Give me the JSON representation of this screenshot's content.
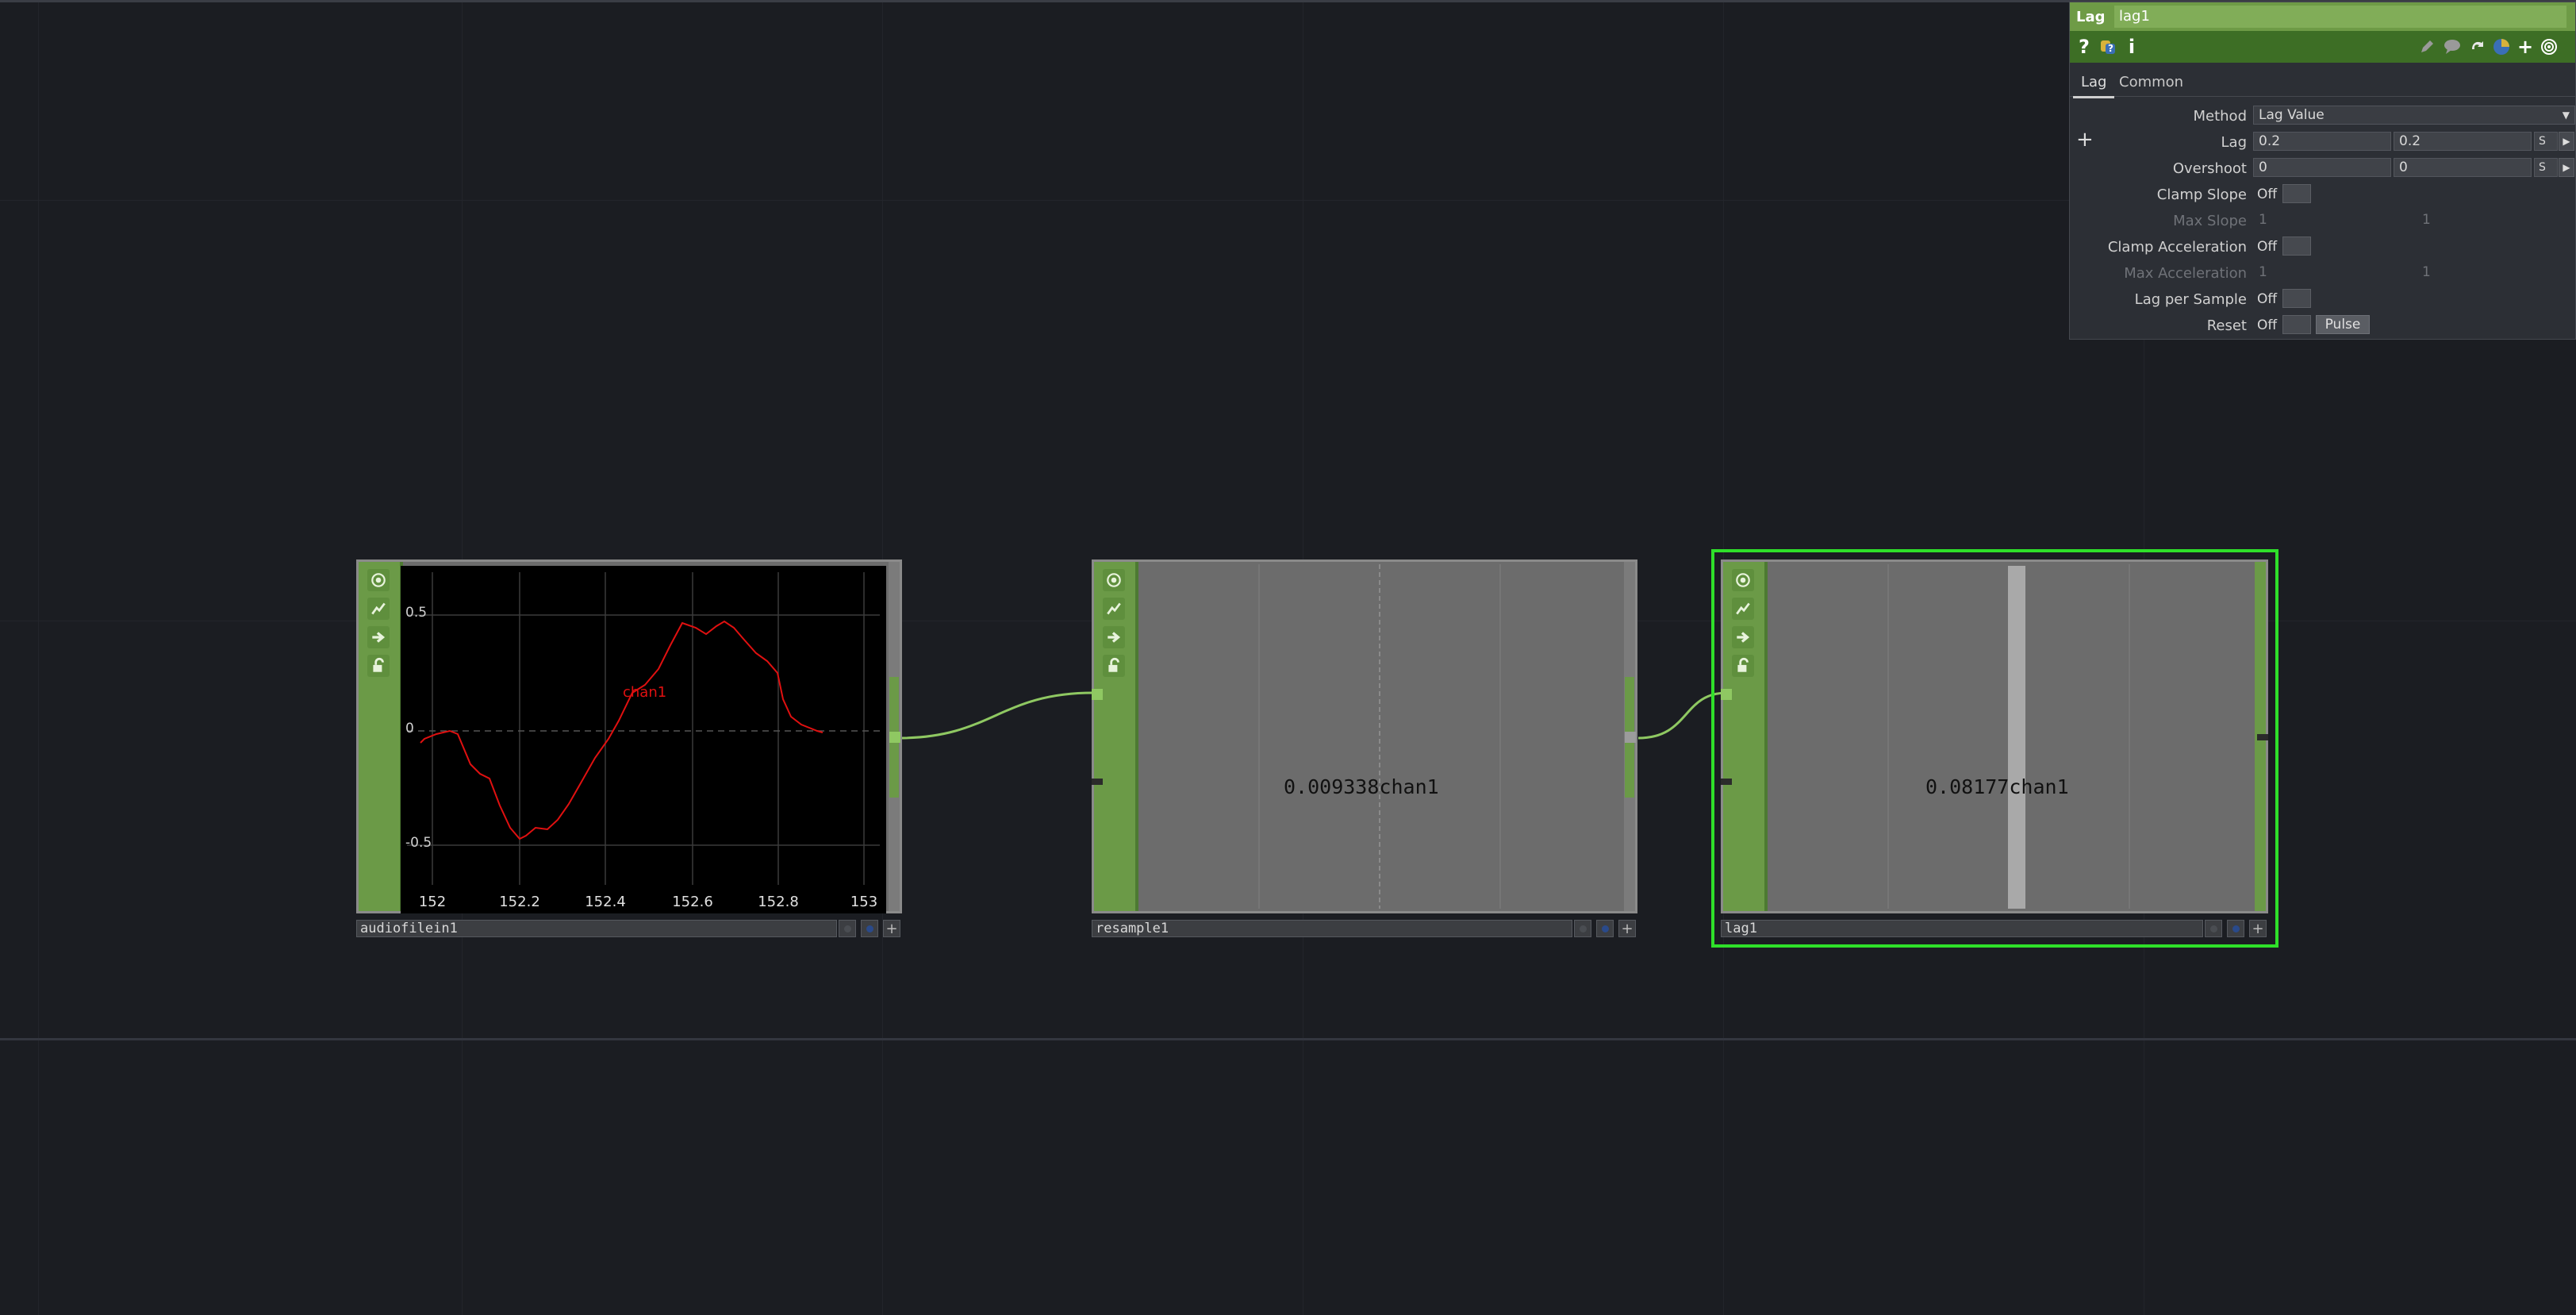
{
  "nodes": {
    "audiofilein1": {
      "name": "audiofilein1",
      "channel": "chan1",
      "plot": {
        "x_ticks": [
          "152",
          "152.2",
          "152.4",
          "152.6",
          "152.8",
          "153"
        ],
        "y_ticks": [
          "0.5",
          "0",
          "-0.5"
        ],
        "line_color": "#e01010"
      }
    },
    "resample1": {
      "name": "resample1",
      "value": "0.009338",
      "channel": "chan1"
    },
    "lag1": {
      "name": "lag1",
      "value": "0.08177",
      "channel": "chan1"
    }
  },
  "panel": {
    "op_type": "Lag",
    "op_name": "lag1",
    "icons": [
      "help-icon",
      "python-help-icon",
      "info-icon",
      "edit-icon",
      "comment-icon",
      "bypass-icon",
      "python-icon",
      "add-icon",
      "viewer-icon"
    ],
    "help_glyph": "?",
    "info_glyph": "i",
    "plus_glyph": "+",
    "tabs": [
      "Lag",
      "Common"
    ],
    "params": {
      "method": {
        "label": "Method",
        "value": "Lag Value"
      },
      "lag": {
        "label": "Lag",
        "value1": "0.2",
        "value2": "0.2",
        "unit": "S"
      },
      "overshoot": {
        "label": "Overshoot",
        "value1": "0",
        "value2": "0",
        "unit": "S"
      },
      "clamp_slope": {
        "label": "Clamp Slope",
        "state": "Off"
      },
      "max_slope": {
        "label": "Max Slope",
        "value1": "1",
        "value2": "1"
      },
      "clamp_acceleration": {
        "label": "Clamp Acceleration",
        "state": "Off"
      },
      "max_acceleration": {
        "label": "Max Acceleration",
        "value1": "1",
        "value2": "1"
      },
      "lag_per_sample": {
        "label": "Lag per Sample",
        "state": "Off"
      },
      "reset": {
        "label": "Reset",
        "state": "Off",
        "pulse_label": "Pulse"
      }
    }
  },
  "colors": {
    "node_green": "#6b9a47",
    "selection": "#2fe02a",
    "wire": "#8fc862",
    "background": "#1b1d22"
  }
}
